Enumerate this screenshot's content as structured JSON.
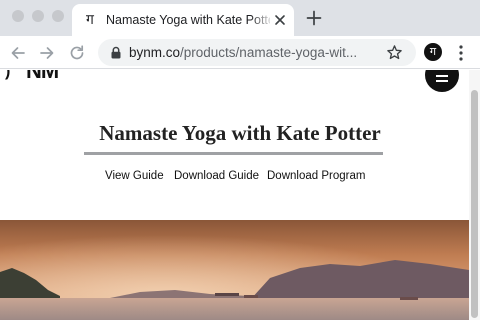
{
  "browser": {
    "tab": {
      "favicon_glyph": "ग",
      "title": "Namaste Yoga with Kate Potter"
    },
    "address": {
      "host": "bynm.co",
      "path": "/products/namaste-yoga-wit..."
    },
    "profile_glyph": "ग",
    "icons": [
      "close-icon",
      "plus-icon",
      "back-arrow-icon",
      "forward-arrow-icon",
      "reload-icon",
      "lock-icon",
      "star-icon",
      "more-vert-icon"
    ]
  },
  "site": {
    "logo_text": "NM",
    "logo_mark": ")",
    "title": "Namaste Yoga with Kate Potter",
    "links": [
      {
        "label": "View Guide"
      },
      {
        "label": "Download Guide"
      },
      {
        "label": "Download Program"
      }
    ],
    "hero_image": "sunset-bay-image"
  },
  "colors": {
    "tab_strip": "#dee1e6",
    "omnibox": "#f1f3f4",
    "rule": "#9fa1a4",
    "menu_button": "#111111"
  }
}
